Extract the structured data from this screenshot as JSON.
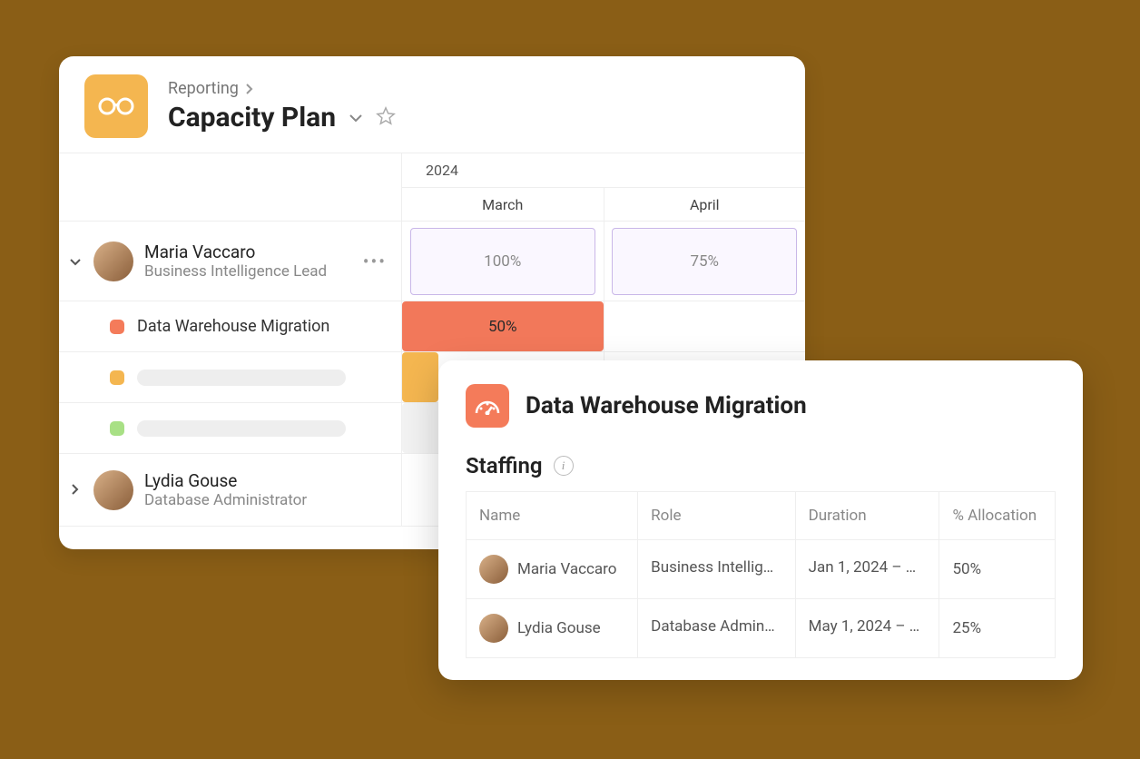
{
  "header": {
    "breadcrumb": "Reporting",
    "title": "Capacity Plan"
  },
  "timeline": {
    "year": "2024",
    "months": [
      "March",
      "April"
    ]
  },
  "people": [
    {
      "name": "Maria Vaccaro",
      "role": "Business Intelligence Lead",
      "expanded": true,
      "allocations": [
        "100%",
        "75%"
      ],
      "projects": [
        {
          "name": "Data Warehouse Migration",
          "color": "orange",
          "bars": [
            {
              "label": "50%",
              "style": "bar-orange"
            },
            null
          ]
        },
        {
          "name": "",
          "color": "amber",
          "bars": [
            {
              "label": "",
              "style": "bar-amber"
            },
            null
          ]
        },
        {
          "name": "",
          "color": "green",
          "bars": [
            {
              "label": "",
              "style": "bar-grey"
            },
            null
          ]
        }
      ]
    },
    {
      "name": "Lydia Gouse",
      "role": "Database Administrator",
      "expanded": false,
      "allocations": [
        "",
        ""
      ],
      "projects": []
    }
  ],
  "popup": {
    "title": "Data Warehouse Migration",
    "section": "Staffing",
    "columns": [
      "Name",
      "Role",
      "Duration",
      "% Allocation"
    ],
    "rows": [
      {
        "name": "Maria Vaccaro",
        "role": "Business Intellig…",
        "duration": "Jan 1, 2024 – …",
        "allocation": "50%"
      },
      {
        "name": "Lydia Gouse",
        "role": "Database Admin…",
        "duration": "May 1, 2024 – …",
        "allocation": "25%"
      }
    ]
  }
}
